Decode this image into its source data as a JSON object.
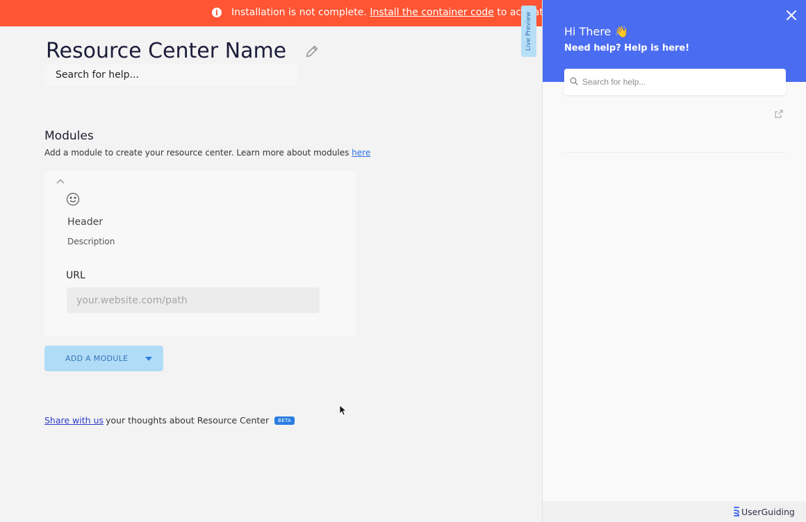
{
  "banner": {
    "text_before": "Installation is not complete.",
    "link_text": "Install the container code",
    "text_after": "to activate"
  },
  "editor": {
    "title": "Resource Center Name",
    "search_placeholder": "Search for help...",
    "modules_title": "Modules",
    "modules_desc": "Add a module to create your resource center. Learn more about modules",
    "modules_link": "here",
    "module": {
      "header": "Header",
      "description": "Description",
      "url_label": "URL",
      "url_placeholder": "your.website.com/path"
    },
    "add_module_label": "ADD A MODULE",
    "share_link": "Share with us",
    "share_text": "your thoughts about Resource Center",
    "beta_badge": "BETA"
  },
  "live_preview_label": "Live Preview",
  "help_panel": {
    "greeting": "Hi There 👋",
    "subtitle": "Need help? Help is here!",
    "search_placeholder": "Search for help...",
    "brand": "UserGuiding"
  },
  "colors": {
    "banner": "#ff5533",
    "help_header": "#4a6cf0",
    "add_button": "#b1dcf7",
    "link": "#2b6fe0",
    "beta": "#2a7de1"
  }
}
